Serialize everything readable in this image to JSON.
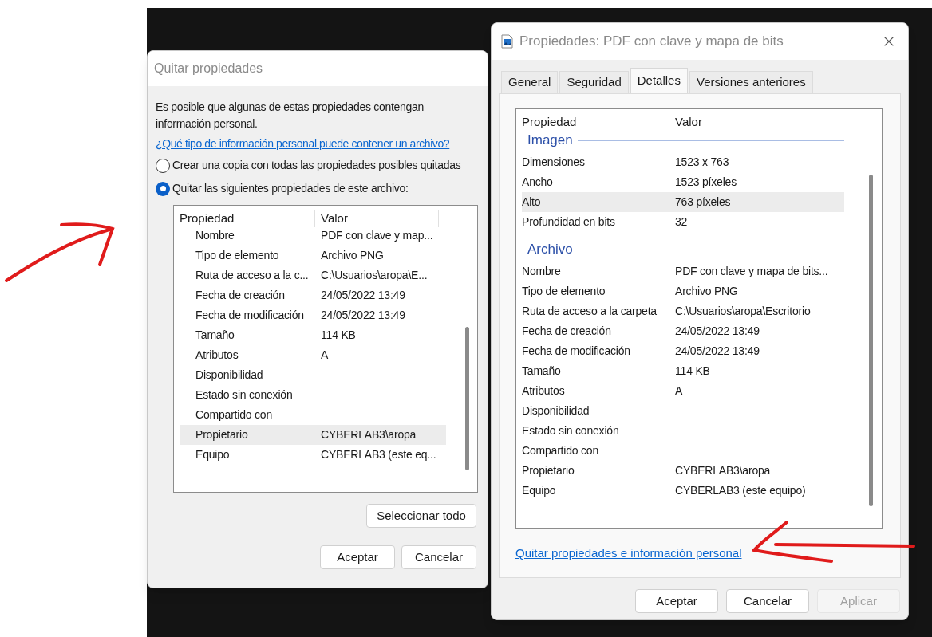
{
  "left_dialog": {
    "title": "Quitar propiedades",
    "intro": "Es posible que algunas de estas propiedades contengan información personal.",
    "help_link": "¿Qué tipo de información personal puede contener un archivo?",
    "options": [
      {
        "label": "Crear una copia con todas las propiedades posibles quitadas",
        "selected": false
      },
      {
        "label": "Quitar las siguientes propiedades de este archivo:",
        "selected": true
      }
    ],
    "list": {
      "columns": [
        "Propiedad",
        "Valor"
      ],
      "rows": [
        {
          "property": "Nombre",
          "value": "PDF con clave y map...",
          "selected": false
        },
        {
          "property": "Tipo de elemento",
          "value": "Archivo PNG",
          "selected": false
        },
        {
          "property": "Ruta de acceso a la c...",
          "value": "C:\\Usuarios\\aropa\\E...",
          "selected": false
        },
        {
          "property": "Fecha de creación",
          "value": "24/05/2022 13:49",
          "selected": false
        },
        {
          "property": "Fecha de modificación",
          "value": "24/05/2022 13:49",
          "selected": false
        },
        {
          "property": "Tamaño",
          "value": "114 KB",
          "selected": false
        },
        {
          "property": "Atributos",
          "value": "A",
          "selected": false
        },
        {
          "property": "Disponibilidad",
          "value": "",
          "selected": false
        },
        {
          "property": "Estado sin conexión",
          "value": "",
          "selected": false
        },
        {
          "property": "Compartido con",
          "value": "",
          "selected": false
        },
        {
          "property": "Propietario",
          "value": "CYBERLAB3\\aropa",
          "selected": true
        },
        {
          "property": "Equipo",
          "value": "CYBERLAB3 (este eq...",
          "selected": false
        }
      ]
    },
    "select_all_button": "Seleccionar todo",
    "buttons": [
      {
        "label": "Aceptar",
        "disabled": false
      },
      {
        "label": "Cancelar",
        "disabled": false
      }
    ]
  },
  "right_dialog": {
    "title": "Propiedades: PDF con clave y mapa de bits",
    "tabs": [
      {
        "label": "General",
        "selected": false
      },
      {
        "label": "Seguridad",
        "selected": false
      },
      {
        "label": "Detalles",
        "selected": true
      },
      {
        "label": "Versiones anteriores",
        "selected": false
      }
    ],
    "list": {
      "columns": [
        "Propiedad",
        "Valor"
      ],
      "groups": [
        {
          "title": "Imagen",
          "rows": [
            {
              "property": "Dimensiones",
              "value": "1523 x 763",
              "selected": false
            },
            {
              "property": "Ancho",
              "value": "1523 píxeles",
              "selected": false
            },
            {
              "property": "Alto",
              "value": "763 píxeles",
              "selected": true
            },
            {
              "property": "Profundidad en bits",
              "value": "32",
              "selected": false
            }
          ]
        },
        {
          "title": "Archivo",
          "rows": [
            {
              "property": "Nombre",
              "value": "PDF con clave y mapa de bits...",
              "selected": false
            },
            {
              "property": "Tipo de elemento",
              "value": "Archivo PNG",
              "selected": false
            },
            {
              "property": "Ruta de acceso a la carpeta",
              "value": "C:\\Usuarios\\aropa\\Escritorio",
              "selected": false
            },
            {
              "property": "Fecha de creación",
              "value": "24/05/2022 13:49",
              "selected": false
            },
            {
              "property": "Fecha de modificación",
              "value": "24/05/2022 13:49",
              "selected": false
            },
            {
              "property": "Tamaño",
              "value": "114 KB",
              "selected": false
            },
            {
              "property": "Atributos",
              "value": "A",
              "selected": false
            },
            {
              "property": "Disponibilidad",
              "value": "",
              "selected": false
            },
            {
              "property": "Estado sin conexión",
              "value": "",
              "selected": false
            },
            {
              "property": "Compartido con",
              "value": "",
              "selected": false
            },
            {
              "property": "Propietario",
              "value": "CYBERLAB3\\aropa",
              "selected": false
            },
            {
              "property": "Equipo",
              "value": "CYBERLAB3 (este equipo)",
              "selected": false
            }
          ]
        }
      ]
    },
    "link": "Quitar propiedades e información personal",
    "buttons": [
      {
        "label": "Aceptar",
        "disabled": false
      },
      {
        "label": "Cancelar",
        "disabled": false
      },
      {
        "label": "Aplicar",
        "disabled": true
      }
    ]
  }
}
